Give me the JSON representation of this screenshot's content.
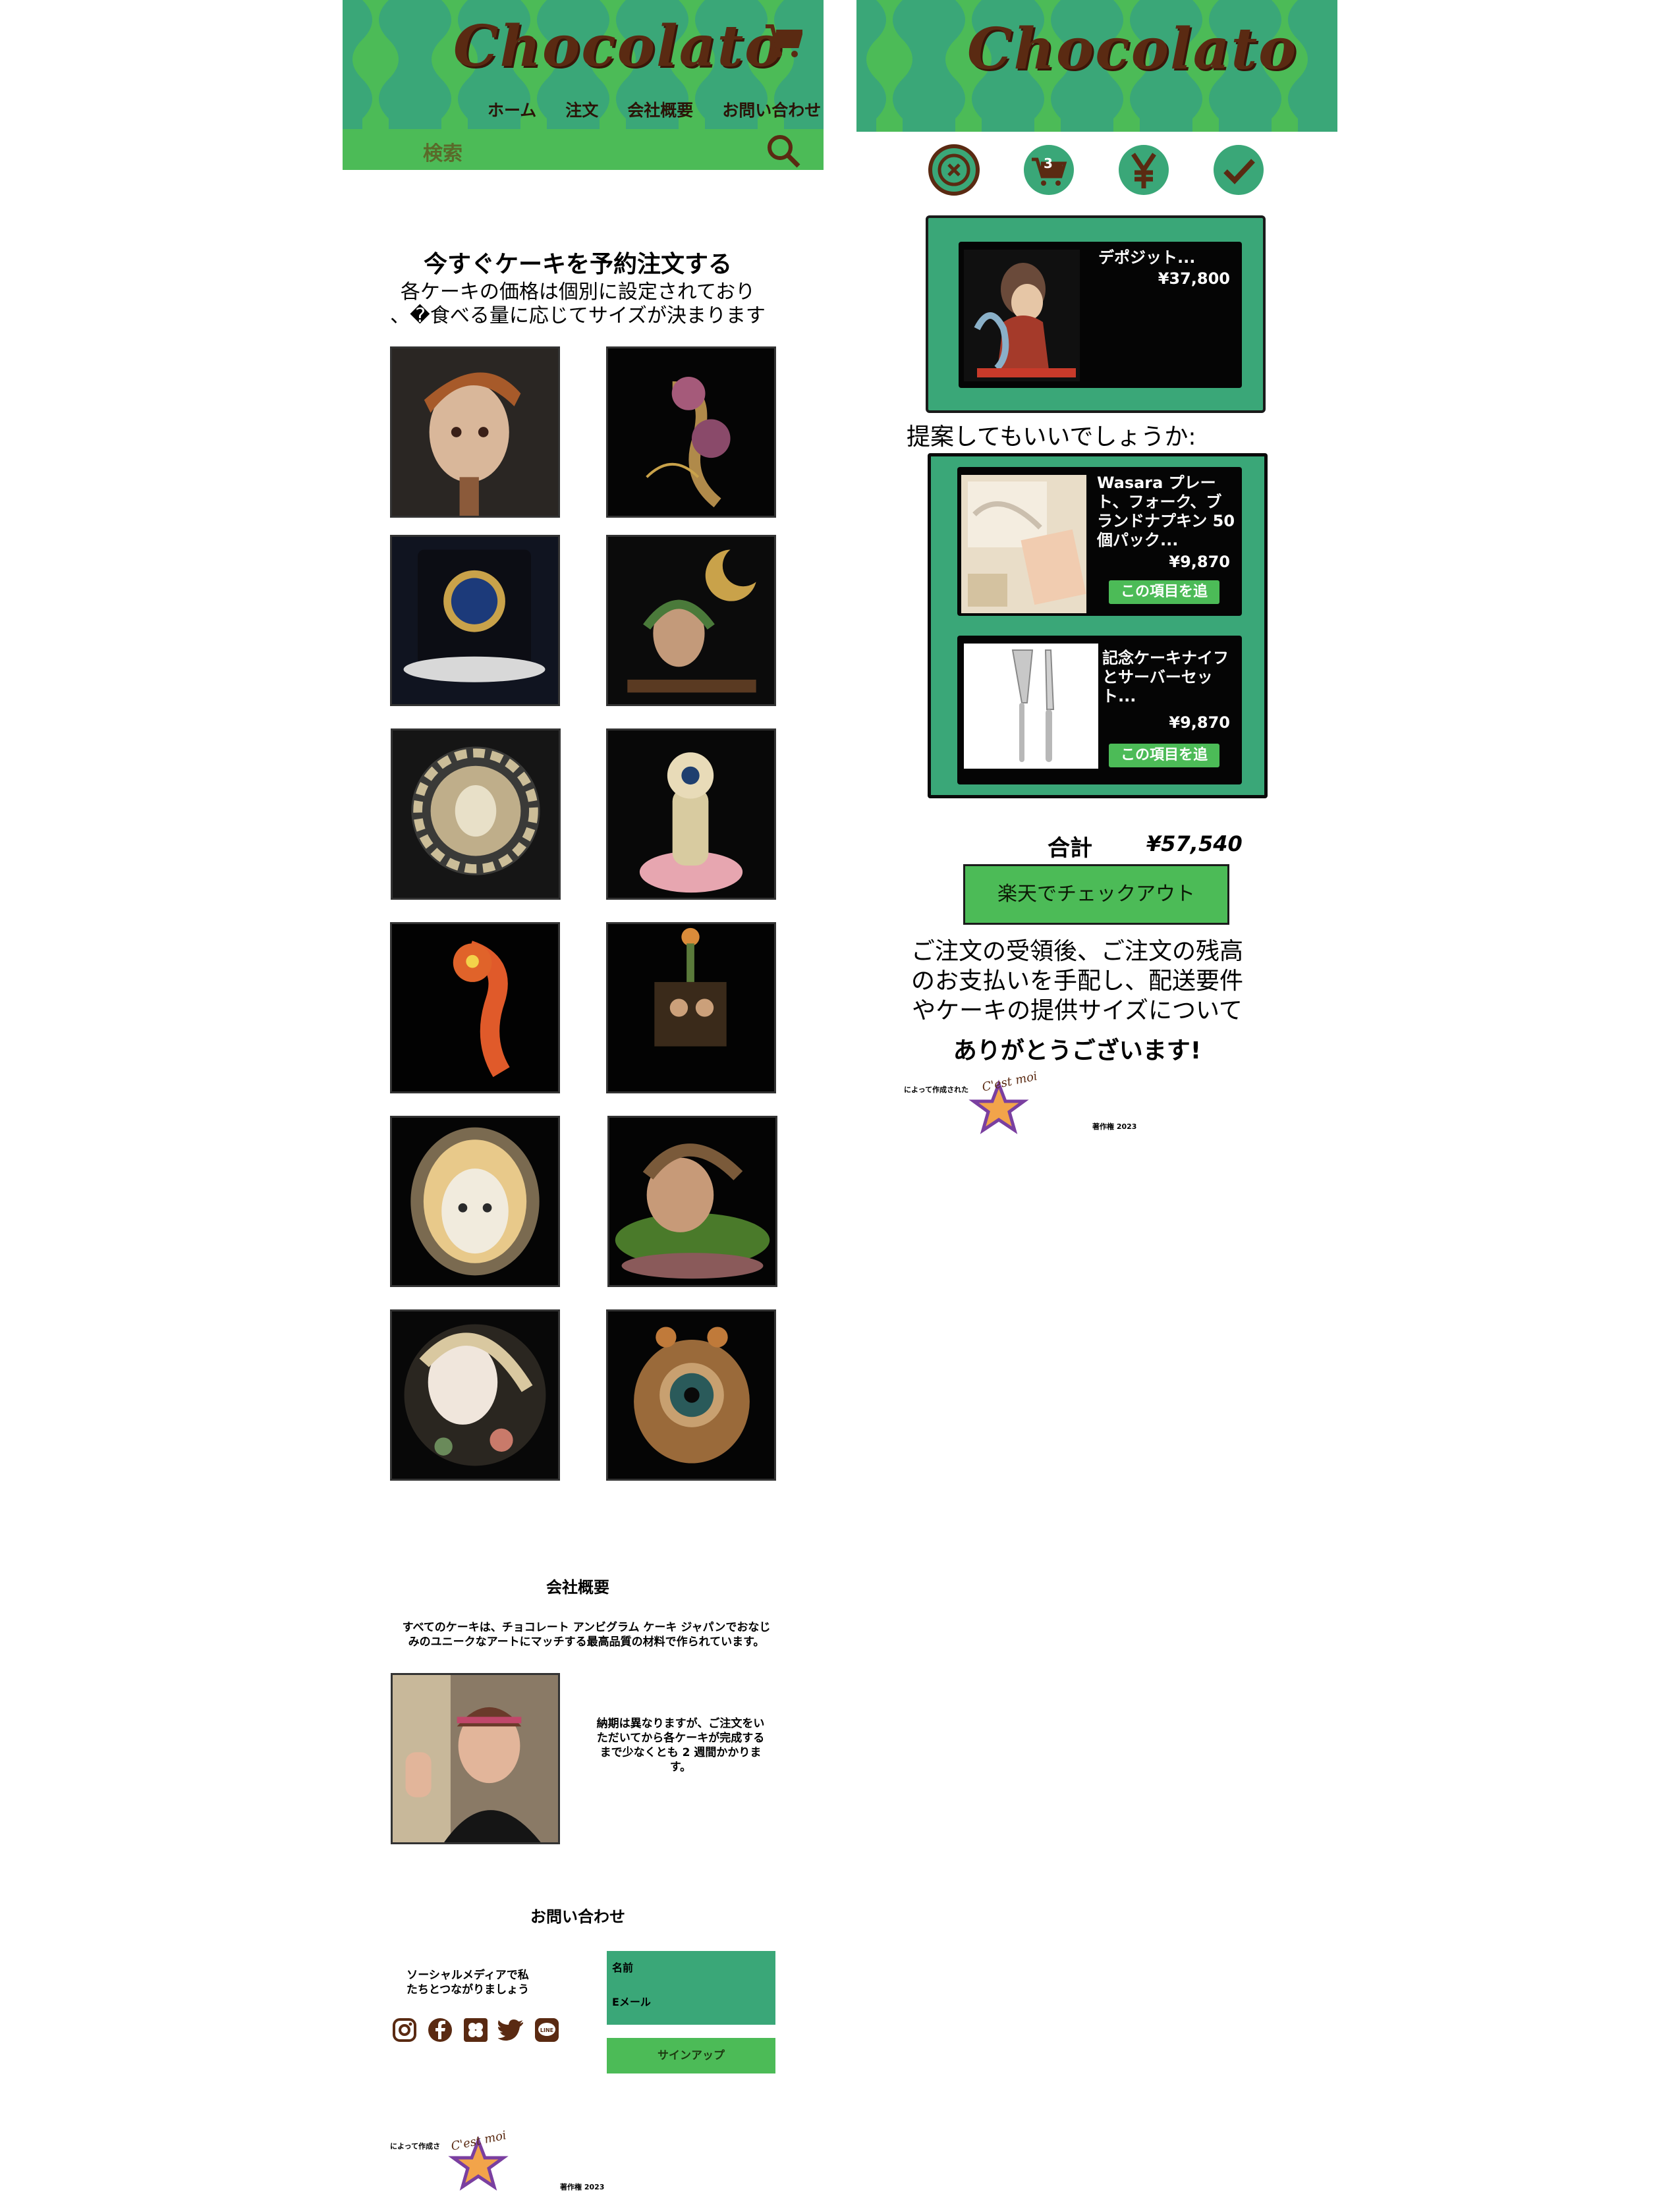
{
  "brand": {
    "logo_text": "Chocolato",
    "green": "#3aa778",
    "light_green": "#4cbb57",
    "brown": "#5a2a12"
  },
  "left": {
    "nav": {
      "home": "ホーム",
      "order": "注文",
      "about": "会社概要",
      "contact": "お問い合わせ"
    },
    "search": {
      "label": "検索"
    },
    "hero": {
      "title": "今すぐケーキを予約注文する",
      "line1": "各ケーキの価格は個別に設定されており",
      "line2": "、�食べる量に応じてサイズが決まります"
    },
    "about": {
      "title": "会社概要",
      "text": "すべてのケーキは、チョコレート アンビグラム ケーキ ジャパンでおなじみのユニークなアートにマッチする最高品質の材料で作られています。",
      "delivery": "納期は異なりますが、ご注文をいただいてから各ケーキが完成するまで少なくとも 2 週間かかります。"
    },
    "contact": {
      "title": "お問い合わせ",
      "social_text": "ソーシャルメディアで私たちとつながりましょう",
      "name_label": "名前",
      "email_label": "Eメール",
      "signup": "サインアップ"
    },
    "footer": {
      "made_by": "によって作成さ",
      "badge": "C'est moi",
      "copyright": "著作権 2023"
    }
  },
  "right": {
    "cart_count": "3",
    "deposit": {
      "name": "デポジット...",
      "price": "¥37,800"
    },
    "suggest_title": "提案してもいいでしょうか:",
    "suggestions": [
      {
        "name": "Wasara プレート、フォーク、ブランドナプキン 50 個パック...",
        "price": "¥9,870",
        "button": "この項目を追"
      },
      {
        "name": "記念ケーキナイフとサーバーセット...",
        "price": "¥9,870",
        "button": "この項目を追"
      }
    ],
    "total_label": "合計",
    "total_value": "¥57,540",
    "checkout": "楽天でチェックアウト",
    "message": "ご注文の受領後、ご注文の残高のお支払いを手配し、配送要件やケーキの提供サイズについて話し合",
    "thanks": "ありがとうございます!",
    "footer": {
      "made_by": "によって作成された",
      "badge": "C'est moi",
      "copyright": "著作権 2023"
    }
  }
}
